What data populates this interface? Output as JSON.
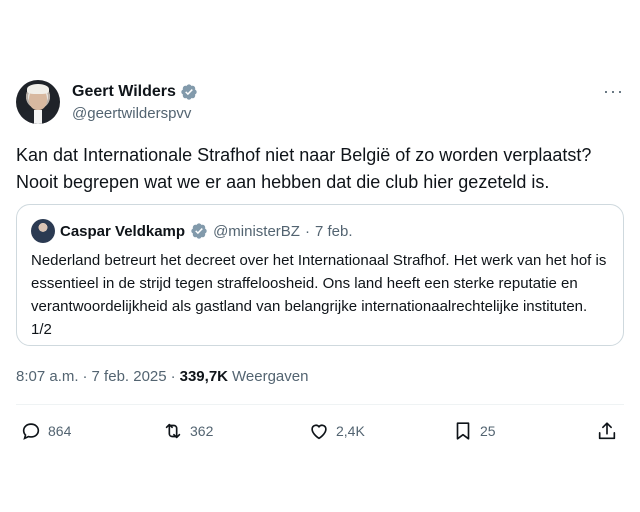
{
  "author": {
    "name": "Geert Wilders",
    "handle": "@geertwilderspvv"
  },
  "tweet": {
    "text": "Kan dat Internationale Strafhof niet naar België of zo worden verplaatst? Nooit begrepen wat we er aan hebben dat die club hier gezeteld is."
  },
  "quoted": {
    "name": "Caspar Veldkamp",
    "handle": "@ministerBZ",
    "separator": "·",
    "date": "7 feb.",
    "text": "Nederland betreurt het decreet over het Internationaal Strafhof. Het werk van het hof is essentieel in de strijd tegen straffeloosheid. Ons land heeft een sterke reputatie en verantwoordelijkheid als gastland van belangrijke internationaalrechtelijke instituten. 1/2"
  },
  "meta": {
    "time": "8:07 a.m.",
    "sep1": "·",
    "date": "7 feb. 2025",
    "sep2": "·",
    "views": "339,7K",
    "views_label": "Weergaven"
  },
  "actions": {
    "replies": "864",
    "reposts": "362",
    "likes": "2,4K",
    "bookmarks": "25"
  },
  "more_label": "···",
  "colors": {
    "verified": "#1d9bf0",
    "secondary_text": "#536471",
    "border": "#cfd9de"
  }
}
